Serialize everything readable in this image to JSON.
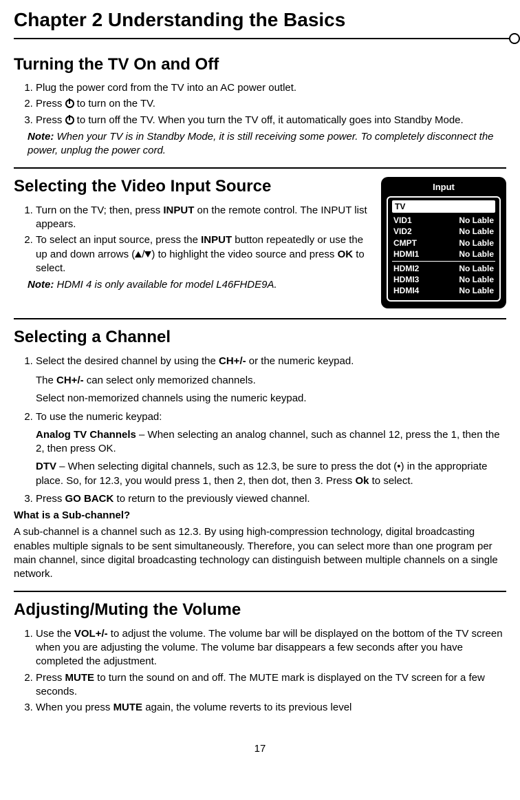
{
  "chapter": {
    "title": "Chapter 2 Understanding the Basics"
  },
  "section1": {
    "heading": "Turning the TV On and Off",
    "step1": "Plug the power cord from the TV into an AC power outlet.",
    "step2a": "Press ",
    "step2b": " to turn on the TV.",
    "step3a": "Press ",
    "step3b": " to turn off the TV. When you turn the TV off, it automatically goes into Standby Mode.",
    "note_label": "Note:",
    "note_text": " When your TV is in Standby Mode, it is still receiving some power. To completely disconnect the power, unplug the power cord."
  },
  "section2": {
    "heading": "Selecting the Video Input Source",
    "step1a": "Turn on the TV; then, press ",
    "step1b": "INPUT",
    "step1c": " on the remote control. The INPUT list appears.",
    "step2a": "To select an input source, press the ",
    "step2b": "INPUT",
    "step2c": " button repeatedly or use the up and down arrows (",
    "step2d": ") to highlight the video source and press ",
    "step2e": "OK",
    "step2f": " to select.",
    "note_label": "Note:",
    "note_text": " HDMI 4 is only available for model L46FHDE9A."
  },
  "inputbox": {
    "title": "Input",
    "tv": "TV",
    "nolabel": "No Lable",
    "rows_a": [
      "VID1",
      "VID2",
      "CMPT",
      "HDMI1"
    ],
    "rows_b": [
      "HDMI2",
      "HDMI3",
      "HDMI4"
    ]
  },
  "section3": {
    "heading": "Selecting a Channel",
    "s1a": "Select the desired channel by using the ",
    "s1b": "CH+/-",
    "s1c": " or the numeric keypad.",
    "s1_sub1a": "The ",
    "s1_sub1b": "CH+/-",
    "s1_sub1c": " can select only memorized channels.",
    "s1_sub2": "Select non-memorized channels using the numeric keypad.",
    "s2": "To use the numeric keypad:",
    "s2_analog_label": "Analog TV Channels",
    "s2_analog_text": " – When selecting an analog channel, such as channel 12, press the 1, then the 2, then press OK.",
    "s2_dtv_label": "DTV",
    "s2_dtv_text_a": " – When selecting digital channels, such as 12.3, be sure to press the dot (•) in the appropriate place. So, for 12.3, you would press 1, then 2, then dot, then 3. Press ",
    "s2_dtv_text_b": "Ok",
    "s2_dtv_text_c": " to select.",
    "s3a": "Press ",
    "s3b": "GO BACK",
    "s3c": " to return to the previously viewed channel.",
    "subq": "What is a Sub-channel?",
    "subq_text": "A sub-channel is a channel such as 12.3. By using high-compression technology, digital broadcasting enables multiple signals to be sent simultaneously. Therefore, you can select more than one program per main channel, since digital broadcasting technology can distinguish between multiple channels on a single network."
  },
  "section4": {
    "heading": "Adjusting/Muting the Volume",
    "s1a": "Use the ",
    "s1b": "VOL+/-",
    "s1c": " to adjust the volume. The volume bar will be displayed on the bottom of the TV screen when you are adjusting the volume. The volume bar disappears a few seconds after you have completed the adjustment.",
    "s2a": "Press ",
    "s2b": "MUTE",
    "s2c": " to turn the sound on and off. The MUTE mark is displayed on the TV screen for a few seconds.",
    "s3a": "When you press ",
    "s3b": "MUTE",
    "s3c": " again, the volume reverts to its previous level"
  },
  "page": "17"
}
